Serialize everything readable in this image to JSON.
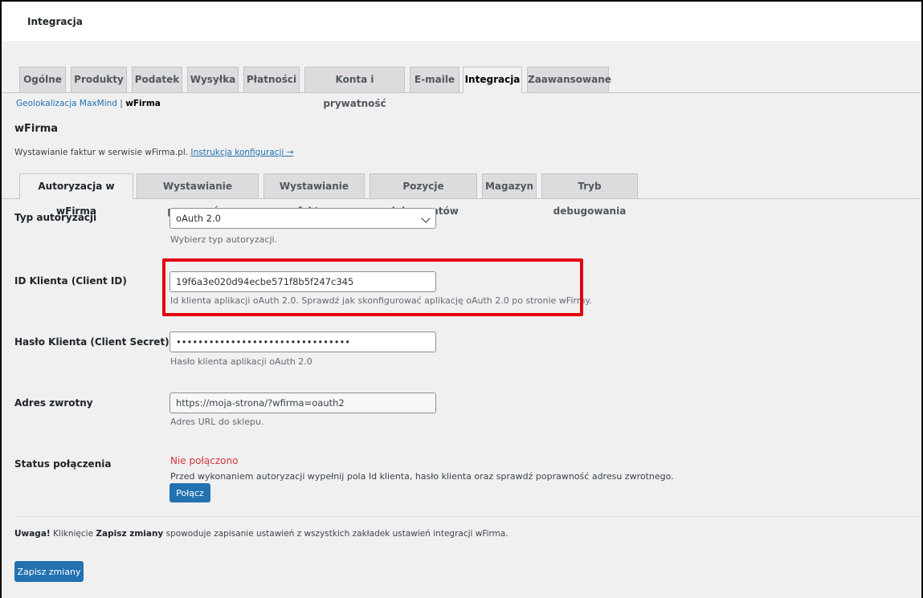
{
  "header": {
    "title": "Integracja"
  },
  "main_tabs": [
    {
      "label": "Ogólne"
    },
    {
      "label": "Produkty"
    },
    {
      "label": "Podatek"
    },
    {
      "label": "Wysyłka"
    },
    {
      "label": "Płatności"
    },
    {
      "label": "Konta i prywatność"
    },
    {
      "label": "E-maile"
    },
    {
      "label": "Integracja"
    },
    {
      "label": "Zaawansowane"
    }
  ],
  "sub_nav": {
    "maxmind": "Geolokalizacja MaxMind",
    "separator": "|",
    "wfirma": "wFirma"
  },
  "section": {
    "title": "wFirma",
    "description": "Wystawianie faktur w serwisie wFirma.pl.",
    "link": "Instrukcja konfiguracji →"
  },
  "sub_tabs": [
    {
      "label": "Autoryzacja w wFirma"
    },
    {
      "label": "Wystawianie paragonów"
    },
    {
      "label": "Wystawianie faktur"
    },
    {
      "label": "Pozycje dokumentów"
    },
    {
      "label": "Magazyn"
    },
    {
      "label": "Tryb debugowania"
    }
  ],
  "fields": {
    "auth_type": {
      "label": "Typ autoryzacji",
      "value": "oAuth 2.0",
      "help": "Wybierz typ autoryzacji."
    },
    "client_id": {
      "label": "ID Klienta (Client ID)",
      "value": "19f6a3e020d94ecbe571f8b5f247c345",
      "help": "Id klienta aplikacji oAuth 2.0. Sprawdź jak skonfigurować aplikację oAuth 2.0 po stronie wFirmy."
    },
    "client_secret": {
      "label": "Hasło Klienta (Client Secret)",
      "value": "••••••••••••••••••••••••••••••••",
      "help": "Hasło klienta aplikacji oAuth 2.0"
    },
    "return_url": {
      "label": "Adres zwrotny",
      "value": "https://moja-strona/?wfirma=oauth2",
      "help": "Adres URL do sklepu."
    },
    "status": {
      "label": "Status połączenia",
      "value": "Nie połączono",
      "help": "Przed wykonaniem autoryzacji wypełnij pola Id klienta, hasło klienta oraz sprawdź poprawność adresu zwrotnego.",
      "button": "Połącz"
    }
  },
  "notice": {
    "strong": "Uwaga!",
    "text1": " Kliknięcie ",
    "strong2": "Zapisz zmiany",
    "text2": " spowoduje zapisanie ustawień z wszystkich zakładek ustawień integracji wFirma."
  },
  "save_button": "Zapisz zmiany",
  "colors": {
    "accent": "#2271b1",
    "highlight": "#e3000f",
    "error": "#d63638"
  }
}
